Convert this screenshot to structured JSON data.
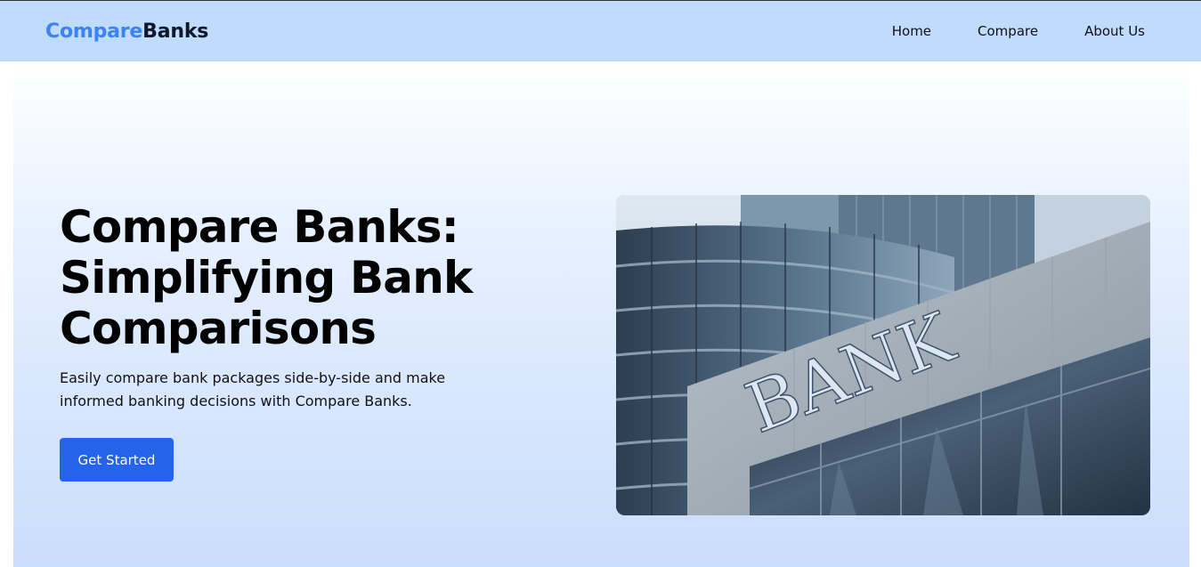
{
  "brand": {
    "part1": "Compare",
    "part2": "Banks"
  },
  "nav": {
    "home": "Home",
    "compare": "Compare",
    "about": "About Us"
  },
  "hero": {
    "title": "Compare Banks: Simplifying Bank Comparisons",
    "subtitle": "Easily compare bank packages side-by-side and make informed banking decisions with Compare Banks.",
    "cta": "Get Started",
    "image_sign_text": "BANK"
  },
  "colors": {
    "nav_bg": "#bfdbfe",
    "brand_accent": "#3b82f6",
    "button": "#2563eb"
  }
}
